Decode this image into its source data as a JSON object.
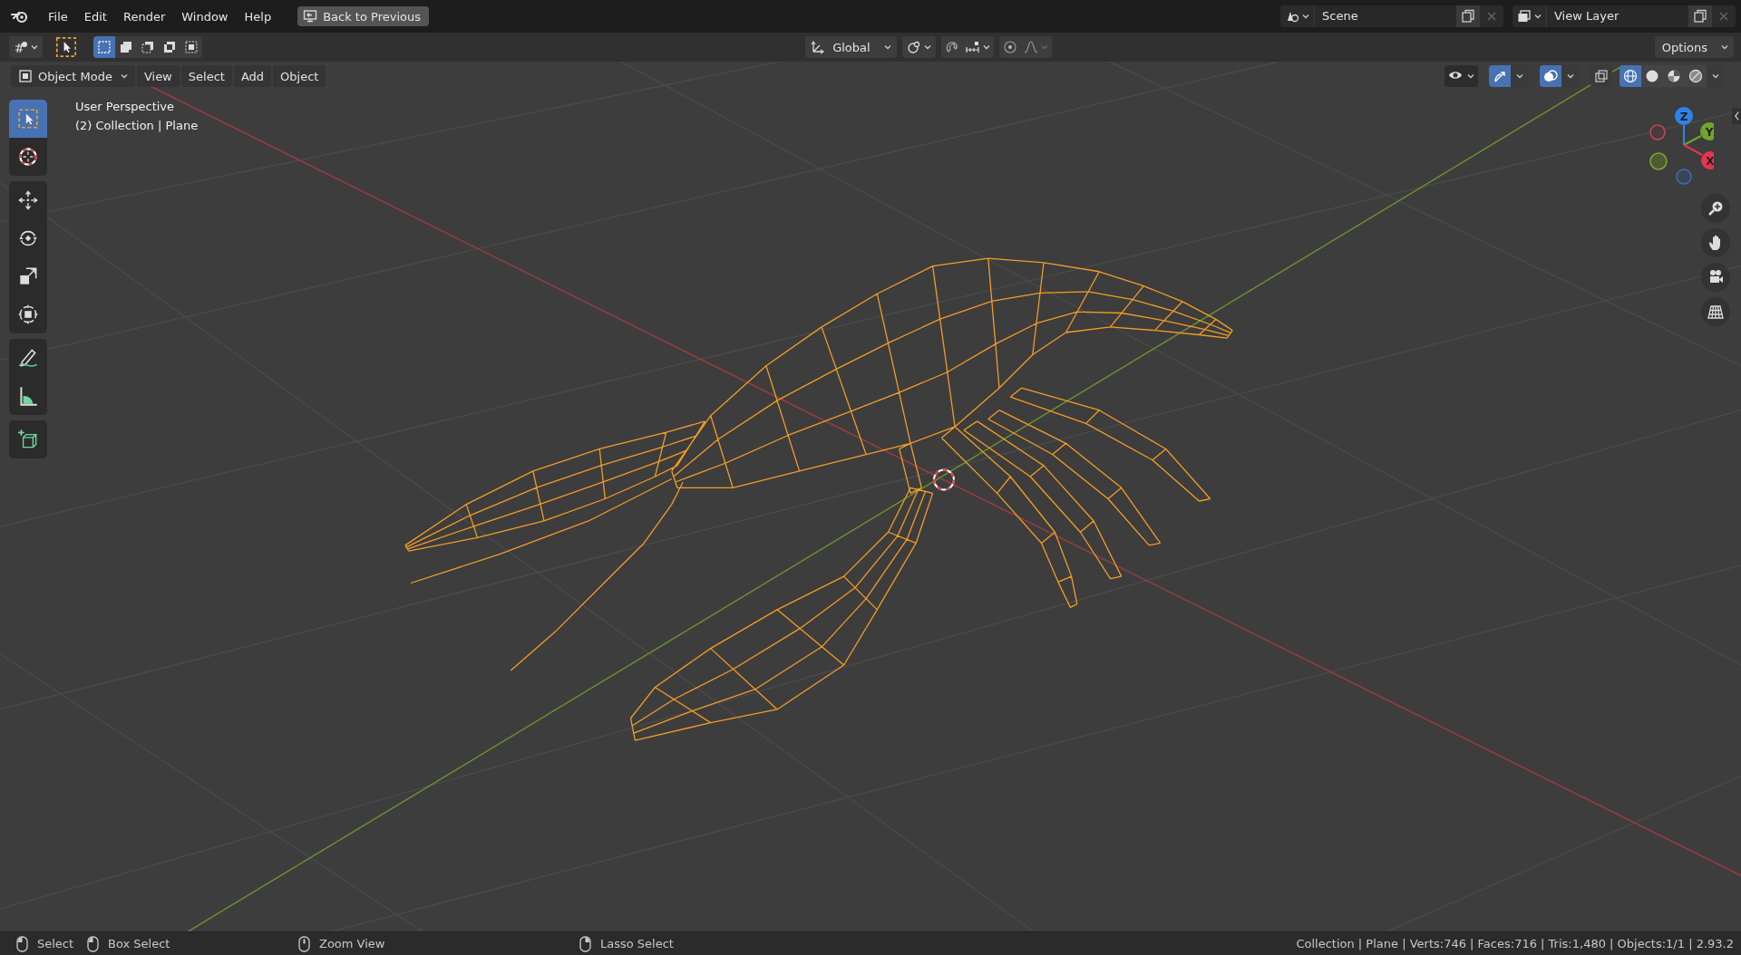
{
  "top_bar": {
    "menus": [
      "File",
      "Edit",
      "Render",
      "Window",
      "Help"
    ],
    "back_button": "Back to Previous",
    "scene": "Scene",
    "view_layer": "View Layer"
  },
  "tool_settings": {
    "select_modes": [
      {
        "kind": "new",
        "selected": true
      },
      {
        "kind": "extend",
        "selected": false
      },
      {
        "kind": "subtract",
        "selected": false
      },
      {
        "kind": "difference",
        "selected": false
      },
      {
        "kind": "intersect",
        "selected": false
      }
    ],
    "orientation": "Global",
    "proportional_editing": false,
    "options": "Options"
  },
  "viewport_header": {
    "mode": "Object Mode",
    "menus": [
      "View",
      "Select",
      "Add",
      "Object"
    ],
    "gizmos_on": true,
    "overlays_on": true,
    "xray_on": false,
    "shading_modes": [
      {
        "kind": "wireframe",
        "selected": true
      },
      {
        "kind": "solid",
        "selected": false
      },
      {
        "kind": "material",
        "selected": false
      },
      {
        "kind": "rendered",
        "selected": false
      }
    ]
  },
  "toolbar": {
    "groups": [
      {
        "tools": [
          {
            "kind": "select_box",
            "selected": true
          },
          {
            "kind": "cursor",
            "selected": false
          }
        ]
      },
      {
        "tools": [
          {
            "kind": "move",
            "selected": false
          },
          {
            "kind": "rotate",
            "selected": false
          },
          {
            "kind": "scale",
            "selected": false
          },
          {
            "kind": "transform",
            "selected": false
          }
        ]
      },
      {
        "tools": [
          {
            "kind": "annotate",
            "selected": false
          },
          {
            "kind": "measure",
            "selected": false
          }
        ]
      },
      {
        "tools": [
          {
            "kind": "add_cube",
            "selected": false
          }
        ]
      }
    ]
  },
  "viewport_info": [
    "User Perspective",
    "(2) Collection | Plane"
  ],
  "nav_gizmo": {
    "axes": [
      {
        "label": "Z",
        "color": "#2f83e8"
      },
      {
        "label": "Y",
        "color": "#6fa52a"
      },
      {
        "label": "X",
        "color": "#e8334f"
      }
    ]
  },
  "status_bar": {
    "hints": [
      {
        "kind": "left_click",
        "label": "Select"
      },
      {
        "kind": "left_drag",
        "label": "Box Select"
      },
      {
        "kind": "middle",
        "label": "Zoom View"
      },
      {
        "kind": "right_drag",
        "label": "Lasso Select"
      }
    ],
    "stats": "Collection | Plane | Verts:746 | Faces:716 | Tris:1,480 | Objects:1/1 | 2.93.2"
  }
}
